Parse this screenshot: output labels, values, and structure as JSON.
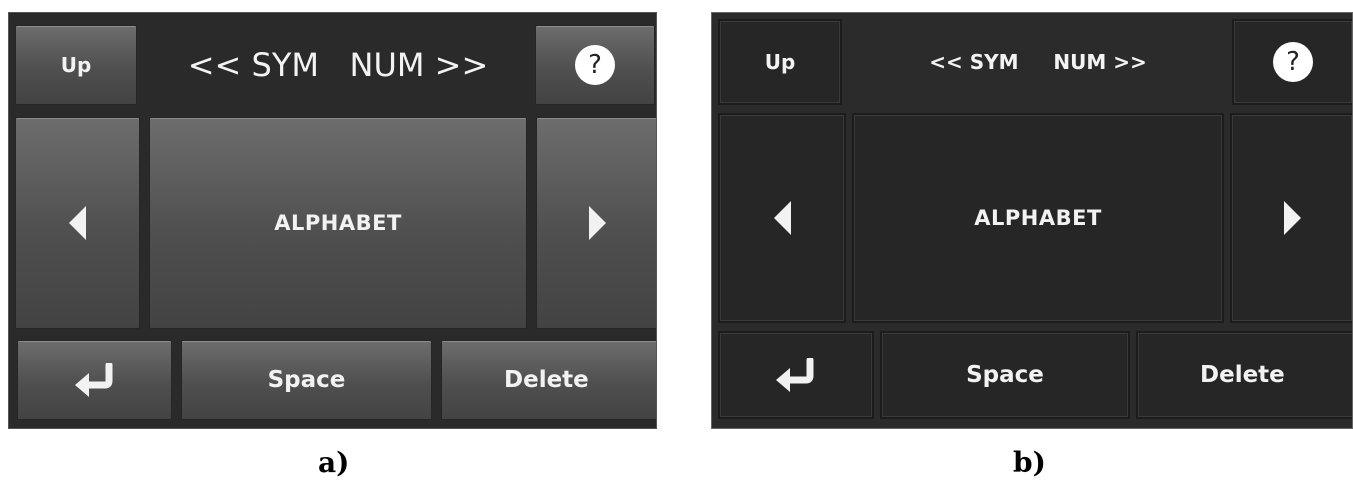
{
  "panels": [
    {
      "id": "a",
      "caption": "a)",
      "up_label": "Up",
      "mode_left": "<< SYM",
      "mode_right": "NUM >>",
      "help_label": "?",
      "main_label": "ALPHABET",
      "prev_icon": "left-triangle-arrow",
      "next_icon": "right-triangle-arrow",
      "enter_icon": "return-arrow",
      "space_label": "Space",
      "delete_label": "Delete"
    },
    {
      "id": "b",
      "caption": "b)",
      "up_label": "Up",
      "mode_left": "<< SYM",
      "mode_right": "NUM >>",
      "help_label": "?",
      "main_label": "ALPHABET",
      "prev_icon": "left-triangle-arrow",
      "next_icon": "right-triangle-arrow",
      "enter_icon": "return-arrow",
      "space_label": "Space",
      "delete_label": "Delete"
    }
  ],
  "colors": {
    "panel_a_key": "#4f4f4f",
    "panel_b_key": "#262626",
    "text": "#f2f2f2",
    "help_circle": "#ffffff"
  }
}
